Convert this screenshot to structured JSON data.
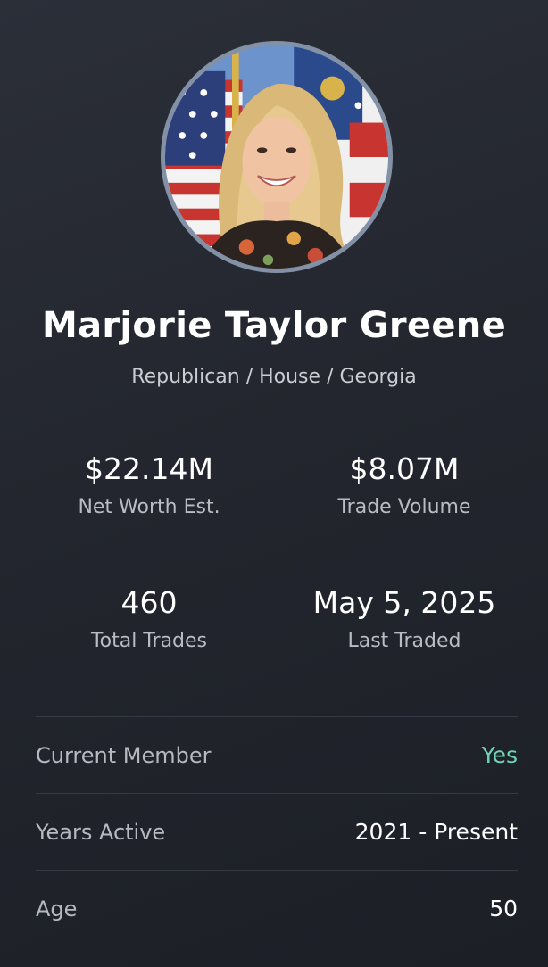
{
  "profile": {
    "name": "Marjorie Taylor Greene",
    "subtitle": "Republican / House / Georgia",
    "avatar_alt": "Marjorie Taylor Greene portrait"
  },
  "stats": [
    {
      "value": "$22.14M",
      "label": "Net Worth Est."
    },
    {
      "value": "$8.07M",
      "label": "Trade Volume"
    },
    {
      "value": "460",
      "label": "Total Trades"
    },
    {
      "value": "May 5, 2025",
      "label": "Last Traded"
    }
  ],
  "details": [
    {
      "label": "Current Member",
      "value": "Yes"
    },
    {
      "label": "Years Active",
      "value": "2021 - Present"
    },
    {
      "label": "Age",
      "value": "50"
    }
  ],
  "colors": {
    "background": "#23262e",
    "avatar_border": "#8391a7",
    "positive": "#6fd2b2"
  }
}
